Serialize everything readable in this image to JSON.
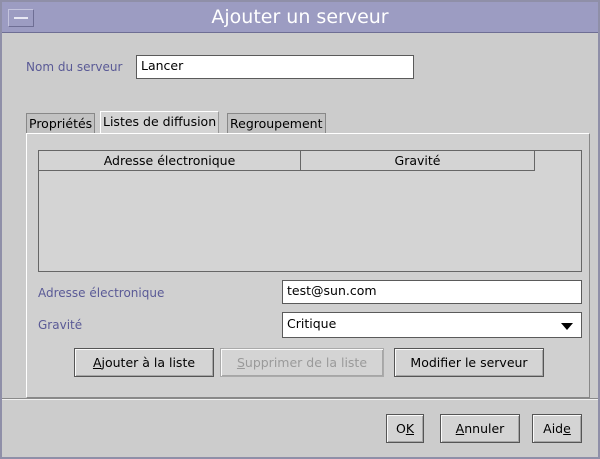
{
  "window": {
    "title": "Ajouter un serveur"
  },
  "server": {
    "name_label": "Nom du serveur",
    "name_value": "Lancer"
  },
  "tabs": [
    {
      "label": "Propriétés"
    },
    {
      "label": "Listes de diffusion"
    },
    {
      "label": "Regroupement"
    }
  ],
  "table": {
    "columns": [
      "Adresse électronique",
      "Gravité"
    ],
    "rows": []
  },
  "form": {
    "email_label": "Adresse électronique",
    "email_value": "test@sun.com",
    "severity_label": "Gravité",
    "severity_value": "Critique"
  },
  "buttons": {
    "add_to_list": {
      "mnemonic": "A",
      "rest": "jouter à la liste"
    },
    "remove_from_list": {
      "mnemonic": "S",
      "rest": "upprimer de la liste"
    },
    "modify_server": "Modifier le serveur",
    "ok": {
      "first": "O",
      "mnemonic": "K"
    },
    "cancel": {
      "mnemonic": "A",
      "rest": "nnuler"
    },
    "help": {
      "first": "Aid",
      "mnemonic": "e"
    }
  },
  "colors": {
    "titlebar": "#9c9cc2",
    "label_text": "#5a5a96",
    "window_bg": "#cccccc"
  }
}
